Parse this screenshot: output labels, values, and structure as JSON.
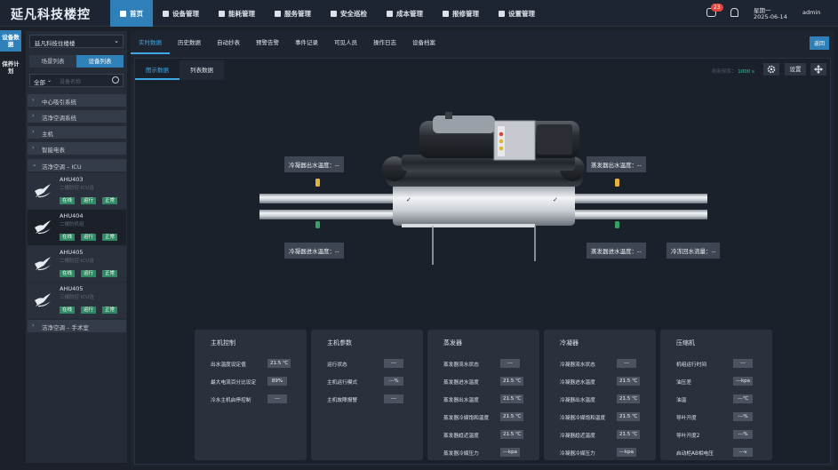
{
  "app": {
    "title": "延凡科技楼控"
  },
  "nav": [
    {
      "label": "首页",
      "active": true,
      "icon": "home-icon"
    },
    {
      "label": "设备管理",
      "icon": "device-icon"
    },
    {
      "label": "能耗管理",
      "icon": "energy-icon"
    },
    {
      "label": "服务管理",
      "icon": "service-icon"
    },
    {
      "label": "安全巡检",
      "icon": "shield-icon"
    },
    {
      "label": "成本管理",
      "icon": "cost-icon"
    },
    {
      "label": "报修管理",
      "icon": "wrench-icon"
    },
    {
      "label": "设置管理",
      "icon": "gear-icon"
    }
  ],
  "header": {
    "msg_count": "23",
    "weekday": "星期一",
    "date": "2025-06-14",
    "user": "admin"
  },
  "rail": [
    {
      "label": "设备数据",
      "active": true
    },
    {
      "label": "保养计划"
    }
  ],
  "sidebar": {
    "select": "延凡科技住楼楼",
    "tabs": [
      "场景列表",
      "设备列表"
    ],
    "filter_value": "全部",
    "filter_placeholder": "设备名称",
    "groups": [
      "中心吸引系统",
      "洁净空调系统",
      "主机",
      "智能电表",
      "洁净空调 – ICU",
      "洁净空调 – 手术室"
    ],
    "devices": [
      {
        "name": "AHU403",
        "sub": "二楼防控 ICU洁",
        "tags": [
          "在线",
          "运行",
          "正常"
        ]
      },
      {
        "name": "AHU404",
        "sub": "二楼防机组",
        "tags": [
          "在线",
          "运行",
          "正常"
        ]
      },
      {
        "name": "AHU405",
        "sub": "二楼防控 ICU洁",
        "tags": [
          "在线",
          "运行",
          "正常"
        ]
      },
      {
        "name": "AHU405",
        "sub": "三楼防控 ICU洁",
        "tags": [
          "在线",
          "运行",
          "正常"
        ]
      }
    ]
  },
  "main": {
    "tabs": [
      "实时数据",
      "历史数据",
      "自动抄表",
      "预警告警",
      "事件记录",
      "可见人员",
      "操作日志",
      "设备档案"
    ],
    "back": "返回",
    "subtabs": [
      "图示数据",
      "列表数据"
    ],
    "refresh_label": "刷新频率：",
    "refresh_value": "1000 s",
    "settings": "设置"
  },
  "diagram": {
    "cond_out": "冷凝器出水温度：--",
    "evap_out": "蒸发器出水温度：--",
    "cond_in": "冷凝器进水温度：--",
    "evap_in": "蒸发器进水温度：--",
    "chill_return": "冷冻回水流量：--"
  },
  "panels": [
    {
      "title": "主机控制",
      "rows": [
        [
          "出水温度设定值",
          "21.5 ℃"
        ],
        [
          "最大电流百分比设定",
          "89%"
        ],
        [
          "冷水主机启停控制",
          "---"
        ]
      ]
    },
    {
      "title": "主机参数",
      "rows": [
        [
          "运行状态",
          "---"
        ],
        [
          "主机运行模式",
          "---%"
        ],
        [
          "主机故障报警",
          "---"
        ]
      ]
    },
    {
      "title": "蒸发器",
      "rows": [
        [
          "蒸发器流水状态",
          "---"
        ],
        [
          "蒸发器进水温度",
          "21.5 ℃"
        ],
        [
          "蒸发器出水温度",
          "21.5 ℃"
        ],
        [
          "蒸发器冷媒饱和温度",
          "21.5 ℃"
        ],
        [
          "蒸发器趋近温度",
          "21.5 ℃"
        ],
        [
          "蒸发器冷媒压力",
          "---kpa"
        ]
      ]
    },
    {
      "title": "冷凝器",
      "rows": [
        [
          "冷凝器流水状态",
          "---"
        ],
        [
          "冷凝器进水温度",
          "21.5 ℃"
        ],
        [
          "冷凝器出水温度",
          "21.5 ℃"
        ],
        [
          "冷凝器冷媒饱和温度",
          "21.5 ℃"
        ],
        [
          "冷凝器趋近温度",
          "21.5 ℃"
        ],
        [
          "冷凝器冷媒压力",
          "---kpa"
        ]
      ]
    },
    {
      "title": "压缩机",
      "rows": [
        [
          "机组运行时间",
          "---"
        ],
        [
          "油压差",
          "---kpa"
        ],
        [
          "油温",
          "---℃"
        ],
        [
          "导叶开度",
          "---%"
        ],
        [
          "导叶开度2",
          "---%"
        ],
        [
          "启动柜AB相电压",
          "---v"
        ]
      ]
    }
  ]
}
